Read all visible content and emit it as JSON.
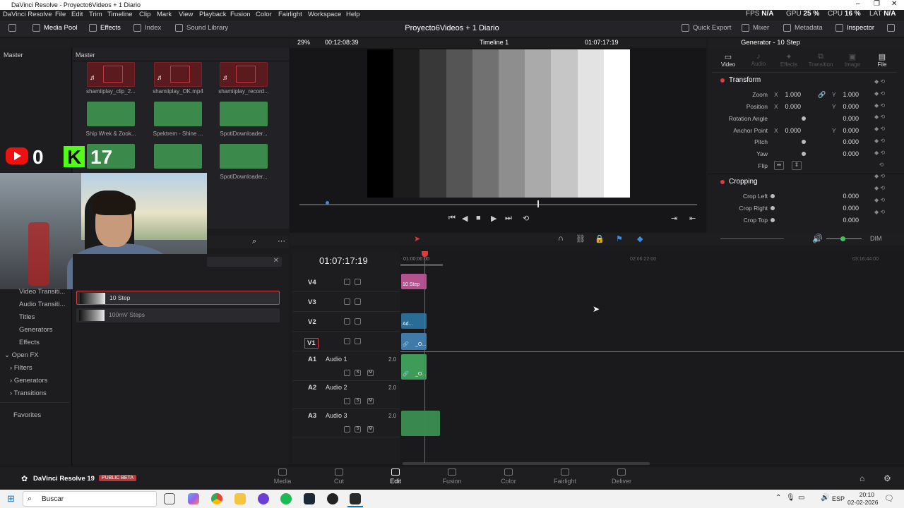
{
  "window": {
    "title": "DaVinci Resolve - Proyecto6Videos + 1 Diario"
  },
  "menu": [
    "DaVinci Resolve",
    "File",
    "Edit",
    "Trim",
    "Timeline",
    "Clip",
    "Mark",
    "View",
    "Playback",
    "Fusion",
    "Color",
    "Fairlight",
    "Workspace",
    "Help"
  ],
  "stats": {
    "fps_label": "FPS",
    "fps": "N/A",
    "gpu_label": "GPU",
    "gpu": "25 %",
    "cpu_label": "CPU",
    "cpu": "16 %",
    "lat_label": "LAT",
    "lat": "N/A"
  },
  "toolbar": {
    "media_pool": "Media Pool",
    "effects": "Effects",
    "index": "Index",
    "sound_library": "Sound Library",
    "project_title": "Proyecto6Videos + 1 Diario",
    "quick_export": "Quick Export",
    "mixer": "Mixer",
    "metadata": "Metadata",
    "inspector": "Inspector"
  },
  "bins": {
    "left_title": "Master",
    "right_title": "Master",
    "clips": [
      "shamiiplay_clip_2...",
      "shamiiplay_OK.mp4",
      "shamiiplay_record...",
      "Ship Wrek & Zook...",
      "Spektrem - Shine ...",
      "SpotiDownloader...",
      "",
      "",
      "SpotiDownloader..."
    ]
  },
  "overlay": {
    "youtube_count": "0",
    "kick_count": "17",
    "kick_letter": "K"
  },
  "effects_tree": [
    "Video Transiti...",
    "Audio Transiti...",
    "Titles",
    "Generators",
    "Effects",
    "Open FX",
    "Filters",
    "Generators",
    "Transitions",
    "Favorites"
  ],
  "generators": [
    "10 Step",
    "100mV Steps"
  ],
  "viewer": {
    "zoom": "29%",
    "duration": "00:12:08:39",
    "timeline_name": "Timeline 1",
    "timecode": "01:07:17:19"
  },
  "timeline": {
    "timecode": "01:07:17:19",
    "ruler": [
      "01:00:00:00",
      "02:06:22:00",
      "03:16:44:00"
    ],
    "tracks": [
      {
        "id": "V4",
        "name": ""
      },
      {
        "id": "V3",
        "name": ""
      },
      {
        "id": "V2",
        "name": ""
      },
      {
        "id": "V1",
        "name": ""
      },
      {
        "id": "A1",
        "name": "Audio 1",
        "level": "2.0"
      },
      {
        "id": "A2",
        "name": "Audio 2",
        "level": "2.0"
      },
      {
        "id": "A3",
        "name": "Audio 3",
        "level": "2.0"
      }
    ],
    "clip_labels": {
      "v4": "10 Step",
      "v2": "Ad...",
      "v1": "_O...",
      "a1": "_O..."
    },
    "dim": "DIM",
    "s": "S",
    "m": "M"
  },
  "inspector": {
    "title": "Generator - 10 Step",
    "tabs": [
      "Video",
      "Audio",
      "Effects",
      "Transition",
      "Image",
      "File"
    ],
    "transform": "Transform",
    "props": [
      {
        "label": "Zoom",
        "x": "1.000",
        "y": "1.000"
      },
      {
        "label": "Position",
        "x": "0.000",
        "y": "0.000"
      },
      {
        "label": "Rotation Angle",
        "v": "0.000"
      },
      {
        "label": "Anchor Point",
        "x": "0.000",
        "y": "0.000"
      },
      {
        "label": "Pitch",
        "v": "0.000"
      },
      {
        "label": "Yaw",
        "v": "0.000"
      },
      {
        "label": "Flip"
      }
    ],
    "cropping": "Cropping",
    "crop": [
      {
        "label": "Crop Left",
        "v": "0.000"
      },
      {
        "label": "Crop Right",
        "v": "0.000"
      },
      {
        "label": "Crop Top",
        "v": "0.000"
      }
    ],
    "x": "X",
    "y": "Y"
  },
  "pages": [
    "Media",
    "Cut",
    "Edit",
    "Fusion",
    "Color",
    "Fairlight",
    "Deliver"
  ],
  "brand": {
    "name": "DaVinci Resolve 19",
    "badge": "PUBLIC BETA"
  },
  "taskbar": {
    "search": "Buscar",
    "lang": "ESP",
    "time": "20:10",
    "date": "02-02-2026"
  },
  "colors": {
    "accent_red": "#e23a3a",
    "clip_pink": "#b2528f",
    "clip_blue": "#2b6c97",
    "clip_green": "#3e9c58"
  }
}
